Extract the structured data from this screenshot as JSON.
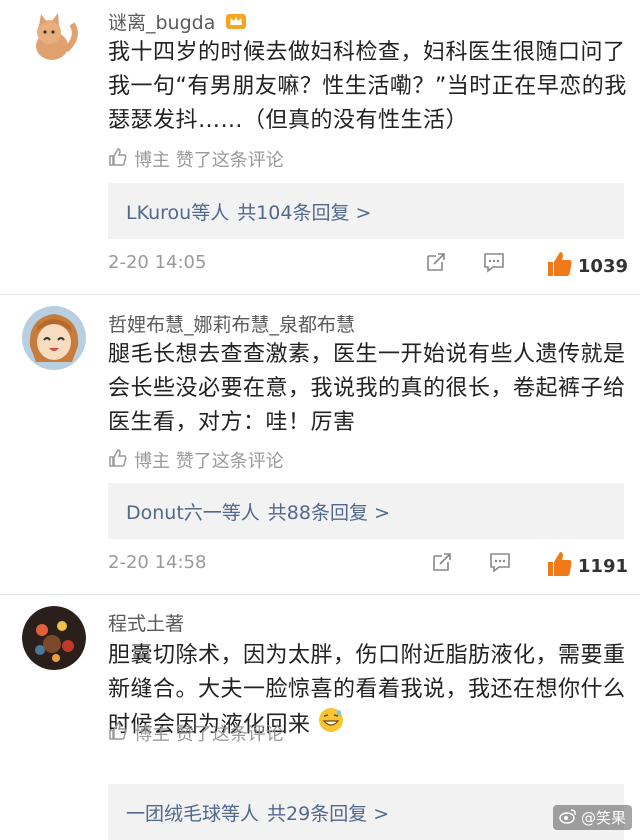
{
  "comments": [
    {
      "username": "谜离_bugda",
      "body": "我十四岁的时候去做妇科检查，妇科医生很随口问了我一句“有男朋友嘛？性生活嘞？”当时正在早恋的我瑟瑟发抖……（但真的没有性生活）",
      "liked_by": "博主 赞了这条评论",
      "reply_who": "LKurou等人",
      "reply_count": "共104条回复 >",
      "time": "2-20 14:05",
      "likes": "1039"
    },
    {
      "username": "哲娌布慧_娜莉布慧_泉都布慧",
      "body": "腿毛长想去查查激素，医生一开始说有些人遗传就是会长些没必要在意，我说我的真的很长，卷起裤子给医生看，对方：哇！厉害",
      "liked_by": "博主 赞了这条评论",
      "reply_who": "Donut六一等人",
      "reply_count": "共88条回复 >",
      "time": "2-20 14:58",
      "likes": "1191"
    },
    {
      "username": "程式土著",
      "body": "胆囊切除术，因为太胖，伤口附近脂肪液化，需要重新缝合。大夫一脸惊喜的看着我说，我还在想你什么时候会因为液化回来",
      "liked_by": "博主 赞了这条评论",
      "reply_who": "一团绒毛球等人",
      "reply_count": "共29条回复 >"
    }
  ],
  "watermark": "@笑果",
  "colors": {
    "link": "#51698c",
    "like": "#f07a1a",
    "muted": "#9a9a9a",
    "badge": "#f5a623"
  }
}
